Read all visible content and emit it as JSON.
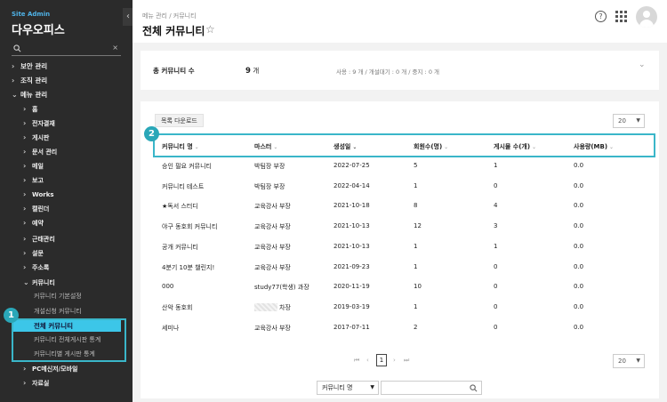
{
  "sidebar": {
    "brand_small": "Site Admin",
    "brand_title": "다우오피스",
    "collapse_glyph": "‹",
    "search_clear": "×",
    "items": [
      {
        "label": "보안 관리",
        "level": "top",
        "chev": "›"
      },
      {
        "label": "조직 관리",
        "level": "top",
        "chev": "›"
      },
      {
        "label": "메뉴 관리",
        "level": "top",
        "chev": "⌄"
      },
      {
        "label": "홈",
        "level": "sub",
        "chev": "›"
      },
      {
        "label": "전자결재",
        "level": "sub",
        "chev": "›"
      },
      {
        "label": "게시판",
        "level": "sub",
        "chev": "›"
      },
      {
        "label": "문서 관리",
        "level": "sub",
        "chev": "›"
      },
      {
        "label": "메일",
        "level": "sub",
        "chev": "›"
      },
      {
        "label": "보고",
        "level": "sub",
        "chev": "›"
      },
      {
        "label": "Works",
        "level": "sub",
        "chev": "›"
      },
      {
        "label": "캘린더",
        "level": "sub",
        "chev": "›"
      },
      {
        "label": "예약",
        "level": "sub",
        "chev": "›"
      },
      {
        "label": "근태관리",
        "level": "sub",
        "chev": "›"
      },
      {
        "label": "설문",
        "level": "sub",
        "chev": "›"
      },
      {
        "label": "주소록",
        "level": "sub",
        "chev": "›"
      },
      {
        "label": "커뮤니티",
        "level": "sub",
        "chev": "⌄"
      },
      {
        "label": "커뮤니티 기본설정",
        "level": "leaf"
      },
      {
        "label": "개설신청 커뮤니티",
        "level": "leaf"
      },
      {
        "label": "전체 커뮤니티",
        "level": "active"
      },
      {
        "label": "커뮤니티 전체게시판 통계",
        "level": "leaf"
      },
      {
        "label": "커뮤니티별 게시판 통계",
        "level": "leaf"
      },
      {
        "label": "PC메신저/모바일",
        "level": "sub",
        "chev": "›"
      },
      {
        "label": "자료실",
        "level": "sub",
        "chev": "›"
      }
    ]
  },
  "header": {
    "breadcrumb": "메뉴 관리 / 커뮤니티",
    "title": "전체 커뮤니티",
    "star": "☆",
    "help": "?"
  },
  "summary": {
    "label": "총 커뮤니티 수",
    "count": "9",
    "count_unit": "개",
    "status": "사용 : 9 개 / 개설대기 : 0 개 / 중지 : 0 개",
    "toggle": "⌄"
  },
  "toolbar": {
    "download_label": "목록 다운로드",
    "page_size": "20",
    "page_size_bottom": "20"
  },
  "table": {
    "headers": [
      {
        "label": "커뮤니티 명",
        "sort": "⌄"
      },
      {
        "label": "마스터",
        "sort": "⌄"
      },
      {
        "label": "생성일",
        "sort": "⌄"
      },
      {
        "label": "회원수(명)",
        "sort": "⌄"
      },
      {
        "label": "게시물 수(개)",
        "sort": "⌄"
      },
      {
        "label": "사용량(MB)",
        "sort": "⌄"
      }
    ],
    "rows": [
      [
        "승인 필요 커뮤니티",
        "박팀장 부장",
        "2022-07-25",
        "5",
        "1",
        "0.0"
      ],
      [
        "커뮤니티 테스트",
        "박팀장 부장",
        "2022-04-14",
        "1",
        "0",
        "0.0"
      ],
      [
        "★독서 스터디",
        "교육강사 부장",
        "2021-10-18",
        "8",
        "4",
        "0.0"
      ],
      [
        "야구 동호회 커뮤니티",
        "교육강사 부장",
        "2021-10-13",
        "12",
        "3",
        "0.0"
      ],
      [
        "공개 커뮤니티",
        "교육강사 부장",
        "2021-10-13",
        "1",
        "1",
        "0.0"
      ],
      [
        "4분기 10분 챌린지!",
        "교육강사 부장",
        "2021-09-23",
        "1",
        "0",
        "0.0"
      ],
      [
        "000",
        "study77(학생) 과장",
        "2020-11-19",
        "10",
        "0",
        "0.0"
      ],
      [
        "산악 동호회",
        "차장",
        "2019-03-19",
        "1",
        "0",
        "0.0"
      ],
      [
        "세미나",
        "교육강사 부장",
        "2017-07-11",
        "2",
        "0",
        "0.0"
      ]
    ]
  },
  "pager": {
    "first": "⏮",
    "prev": "‹",
    "current": "1",
    "next": "›",
    "last": "⏭"
  },
  "search": {
    "field": "커뮤니티 명",
    "keyword": ""
  },
  "annotations": {
    "badge1": "1",
    "badge2": "2"
  },
  "colors": {
    "sidebar_bg": "#2b2b2b",
    "active_item": "#3cc6e8",
    "highlight": "#3ab6c9",
    "brand_blue": "#4fb3e8"
  }
}
